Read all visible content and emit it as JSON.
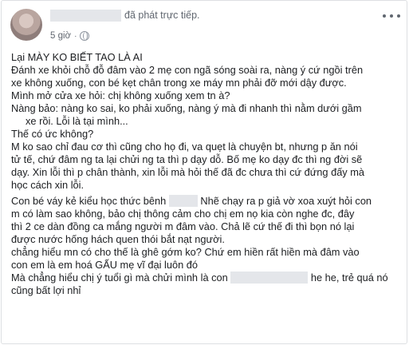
{
  "post": {
    "action_text": "đã phát trực tiếp.",
    "time": "5 giờ",
    "dot": "·"
  },
  "body": {
    "title": "Lại MÀY KO BIẾT TAO LÀ AI",
    "l1": "Đánh xe khỏi chỗ đỗ đâm vào 2 mẹ con ngã sóng soài ra, nàng ý cứ ngồi trên",
    "l2": "xe không xuống, con bé kẹt chân trong xe máy mn phải đỡ mới dậy được.",
    "l3": "Mình mở cửa xe hỏi: chị không xuống xem tn à?",
    "l4": "Nàng bảo: nàng ko sai, ko phải xuống, nàng ý mà đi nhanh thì nằm dưới gầm",
    "l5": "xe rồi. Lỗi là tại mình...",
    "l6": "Thế có ức không?",
    "l7": "M ko sao chỉ đau cơ thì cũng cho họ đi, va quẹt là chuyện bt, nhưng p ăn nói",
    "l8": "tử tế, chứ đâm ng ta lại chửi ng ta thì p dạy dỗ. Bố mẹ ko dạy đc thì ng đời sẽ",
    "l9": "dạy. Xin lỗi thì p chân thành, xin lỗi mà hỏi thế đã đc chưa thì cứ đứng đấy mà",
    "l10": "học cách xin lỗi.",
    "l11a": "Con bé váy kẻ kiểu học thức bênh",
    "l11b": "Nhẽ chạy ra p giả vờ xoa xuýt hỏi con",
    "l12": "m có làm sao không, bảo chị thông cảm cho chị em nọ kia còn nghe đc, đây",
    "l13": "thì 2 ce dàn đồng ca mắng người m đâm vào. Chả lẽ cứ thế đi thì bọn nó lại",
    "l14": "được nước hống hách quen thói bắt nạt người.",
    "l15": "chẳng hiểu mn có cho thế là ghê gớm ko? Chứ em hiền rất hiền mà đâm vào",
    "l16": "con em là em hoá GẤU mẹ vĩ đại luôn đó",
    "l17a": "Mà chẳng hiểu chị ý tuổi gì mà chửi mình là con",
    "l17b": "he he, trẻ quá nó",
    "l18": "cũng bất lợi nhỉ"
  }
}
